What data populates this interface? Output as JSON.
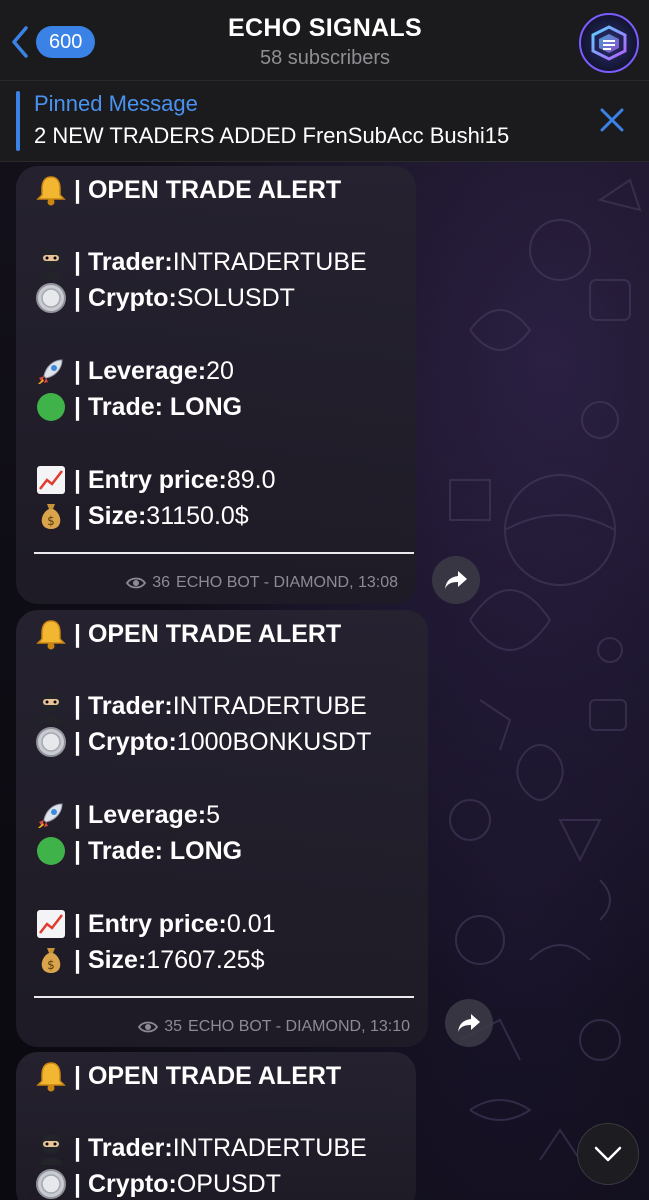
{
  "header": {
    "back_count": "600",
    "title": "ECHO SIGNALS",
    "subtitle": "58 subscribers"
  },
  "pinned": {
    "title": "Pinned Message",
    "text": "2 NEW TRADERS ADDED FrenSubAcc Bushi15"
  },
  "messages": [
    {
      "heading": "| OPEN TRADE ALERT",
      "trader_label": "| Trader:",
      "trader": " INTRADERTUBE",
      "crypto_label": "| Crypto:",
      "crypto": " SOLUSDT",
      "leverage_label": "| Leverage:",
      "leverage": " 20",
      "trade_label": "| Trade: LONG",
      "entry_label": "| Entry price:",
      "entry": "  89.0",
      "size_label": "| Size:",
      "size": " 31150.0$",
      "views": "36",
      "footer": "ECHO BOT - DIAMOND, 13:08"
    },
    {
      "heading": "| OPEN TRADE ALERT",
      "trader_label": "| Trader:",
      "trader": " INTRADERTUBE",
      "crypto_label": "| Crypto:",
      "crypto": " 1000BONKUSDT",
      "leverage_label": "| Leverage:",
      "leverage": " 5",
      "trade_label": "| Trade: LONG",
      "entry_label": "| Entry price:",
      "entry": "  0.01",
      "size_label": "| Size:",
      "size": " 17607.25$",
      "views": "35",
      "footer": "ECHO BOT - DIAMOND, 13:10"
    },
    {
      "heading": "| OPEN TRADE ALERT",
      "trader_label": "| Trader:",
      "trader": " INTRADERTUBE",
      "crypto_label": "| Crypto:",
      "crypto": " OPUSDT"
    }
  ],
  "icons": {
    "bell": "bell-icon",
    "ninja": "ninja-icon",
    "coin": "coin-icon",
    "rocket": "rocket-icon",
    "green_circle": "green-circle-icon",
    "chart": "chart-increasing-icon",
    "money_bag": "money-bag-icon",
    "eye": "eye-icon",
    "share": "share-icon"
  },
  "colors": {
    "accent": "#3b82e6",
    "bubble": "#262230",
    "header": "#1b1b1d"
  }
}
